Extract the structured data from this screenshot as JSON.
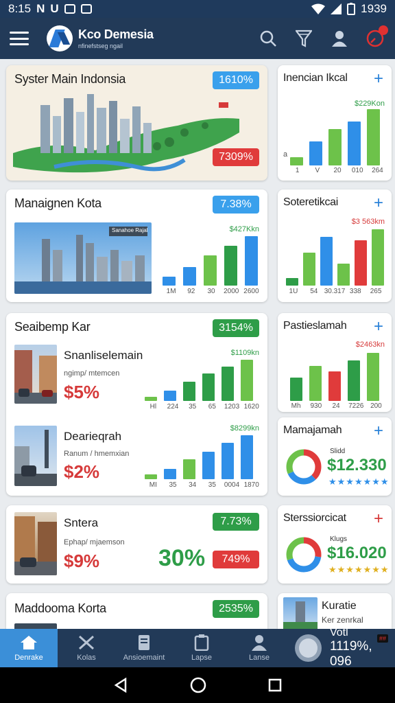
{
  "status": {
    "time": "8:15",
    "clock": "1939",
    "left_glyphs": [
      "N",
      "U"
    ]
  },
  "app": {
    "name": "Kco Demesia",
    "tagline": "nfinefstseg ngail"
  },
  "cards": {
    "c1": {
      "title": "Syster Main Indonsia",
      "pill_top": "1610%",
      "pill_bottom": "7309%"
    },
    "c2": {
      "title": "Inencian Ikcal",
      "value_label": "$229Kon",
      "x_ticks": [
        "1",
        "V",
        "20",
        "010",
        "264"
      ],
      "y_tick": "a",
      "values": [
        10,
        30,
        45,
        55,
        70
      ]
    },
    "c3": {
      "title": "Manaignen Kota",
      "pill": "7.38%",
      "value_label": "$427Kkn",
      "thumb_caption": "Sanahoe Rajal",
      "x_ticks": [
        "1M",
        "92",
        "30",
        "2000",
        "2600"
      ],
      "values": [
        12,
        24,
        40,
        52,
        65
      ]
    },
    "c4": {
      "title": "Soteretikcai",
      "value_label": "$3 563km",
      "x_ticks": [
        "1U",
        "54",
        "30.317",
        "338",
        "265"
      ],
      "values": [
        10,
        42,
        62,
        28,
        58,
        72
      ]
    },
    "c5": {
      "title": "Seaibemp Kar",
      "pill": "3154%",
      "item1": {
        "title": "Snanliselemain",
        "sub": "ngimp/ mtemcen",
        "pct": "$5%",
        "value_label": "$1109kn",
        "x_ticks": [
          "Hl",
          "224",
          "35",
          "65",
          "1203",
          "1620"
        ],
        "values": [
          5,
          12,
          22,
          32,
          40,
          48
        ]
      },
      "item2": {
        "title": "Dearieqrah",
        "sub": "Ranum / hmemxian",
        "pct": "$2%",
        "value_label": "$8299kn",
        "x_ticks": [
          "MI",
          "35",
          "34",
          "35",
          "0004",
          "1870"
        ],
        "values": [
          6,
          14,
          26,
          36,
          48,
          58
        ]
      }
    },
    "c6": {
      "title": "Pastieslamah",
      "value_label": "$2463kn",
      "x_ticks": [
        "Mh",
        "930",
        "24",
        "7226",
        "200"
      ],
      "values": [
        30,
        45,
        38,
        52,
        62
      ]
    },
    "c7": {
      "title": "Mamajamah",
      "small": "Slidd",
      "stat": "$12.330",
      "stars": "★★★★★★★"
    },
    "c8": {
      "title": "Sntera",
      "sub": "Ephap/ mjaemson",
      "pct": "$9%",
      "big": "30%",
      "pill_top": "7.73%",
      "pill_bottom": "749%"
    },
    "c9": {
      "title": "Sterssiorcicat",
      "small": "Klugs",
      "stat": "$16.020",
      "stars": "★★★★★★★"
    },
    "c10": {
      "title": "Maddooma Korta",
      "pill": "2535%"
    },
    "c11": {
      "title": "Kuratie",
      "sub": "Ker zenrkal"
    }
  },
  "colors": {
    "blue": "#2f8fe8",
    "green": "#2e9d48",
    "lime": "#6dc24a",
    "red": "#e03b3b"
  },
  "nav": {
    "items": [
      {
        "label": "Denrake",
        "icon": "home-icon"
      },
      {
        "label": "Kolas",
        "icon": "tools-icon"
      },
      {
        "label": "Ansioemaint",
        "icon": "document-icon"
      },
      {
        "label": "Lapse",
        "icon": "clipboard-icon"
      },
      {
        "label": "Lanse",
        "icon": "user-icon"
      }
    ],
    "last": {
      "t1": "Votl",
      "t2": "1119%, 096",
      "badge": "##"
    }
  }
}
